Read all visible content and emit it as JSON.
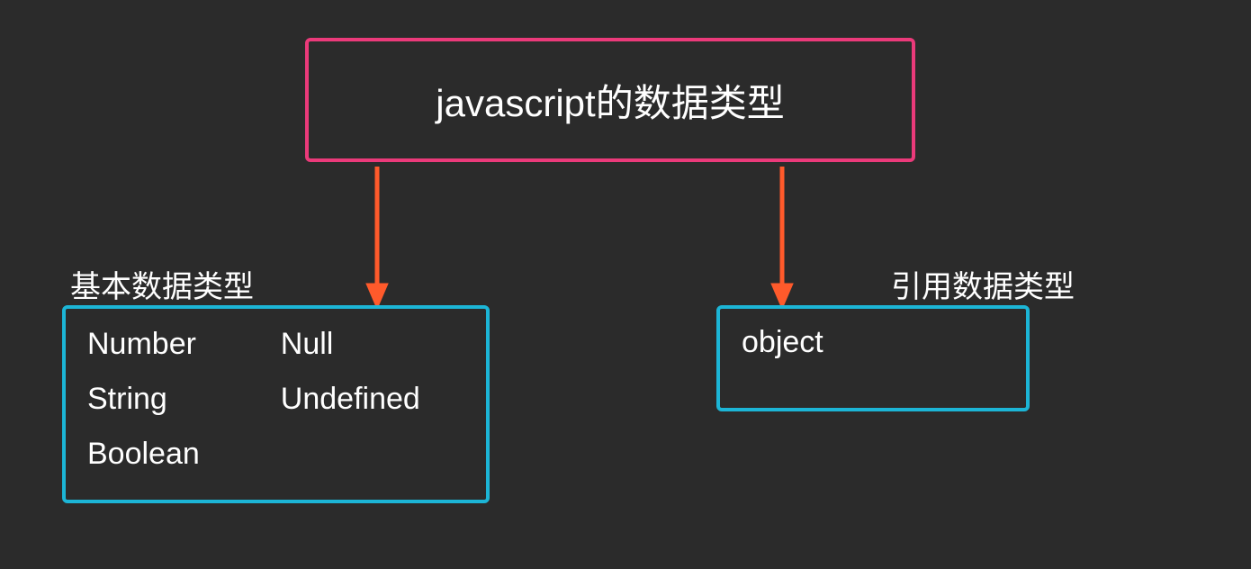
{
  "root": {
    "title": "javascript的数据类型"
  },
  "basic": {
    "label": "基本数据类型",
    "col1": {
      "item1": "Number",
      "item2": "String",
      "item3": "Boolean"
    },
    "col2": {
      "item1": "Null",
      "item2": "Undefined"
    }
  },
  "reference": {
    "label": "引用数据类型",
    "item1": "object"
  },
  "colors": {
    "pink": "#eb3a7a",
    "cyan": "#1cb5d6",
    "orange": "#ff5a2b",
    "bg": "#2b2b2b"
  }
}
